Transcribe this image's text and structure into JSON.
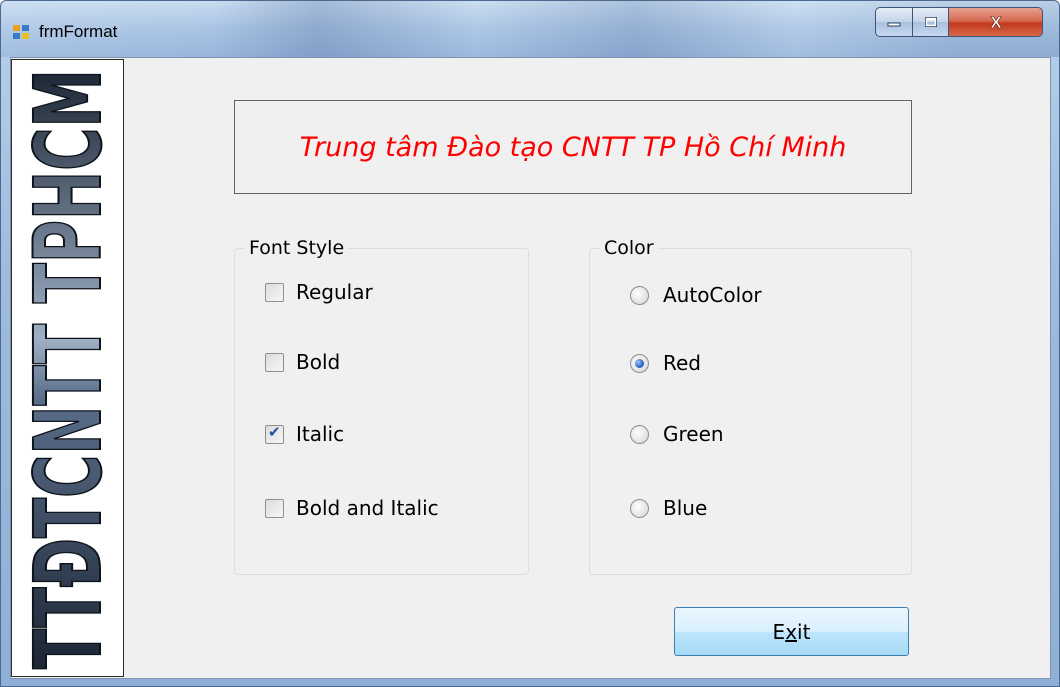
{
  "window": {
    "title": "frmFormat",
    "close_glyph": "X",
    "min_icon": "minimize-icon",
    "max_icon": "maximize-icon"
  },
  "side_logo": {
    "text": "TTĐTCNTT TPHCM"
  },
  "banner": {
    "text": "Trung tâm Đào tạo CNTT TP Hồ Chí Minh",
    "color": "#ff0000"
  },
  "font_style": {
    "title": "Font Style",
    "options": [
      {
        "label": "Regular",
        "checked": false
      },
      {
        "label": "Bold",
        "checked": false
      },
      {
        "label": "Italic",
        "checked": true
      },
      {
        "label": "Bold and Italic",
        "checked": false
      }
    ]
  },
  "color": {
    "title": "Color",
    "options": [
      {
        "label": "AutoColor",
        "selected": false
      },
      {
        "label": "Red",
        "selected": true
      },
      {
        "label": "Green",
        "selected": false
      },
      {
        "label": "Blue",
        "selected": false
      }
    ]
  },
  "exit_button": {
    "label_prefix": "E",
    "label_mnemonic": "x",
    "label_suffix": "it"
  }
}
